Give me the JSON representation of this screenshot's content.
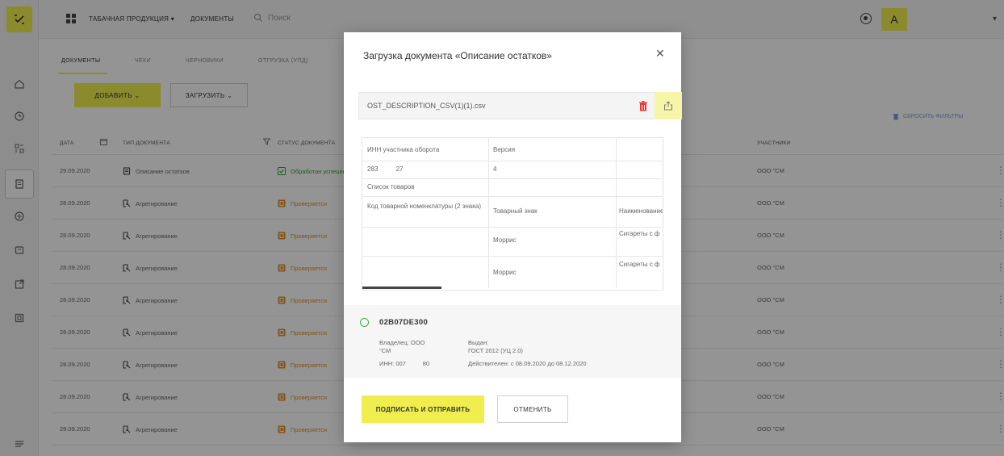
{
  "topbar": {
    "product_menu": "ТАБАЧНАЯ ПРОДУКЦИЯ",
    "documents_link": "ДОКУМЕНТЫ",
    "search_placeholder": "Поиск",
    "avatar_letter": "A"
  },
  "tabs": [
    "ДОКУМЕНТЫ",
    "ЧЕКИ",
    "ЧЕРНОВИКИ",
    "ОТГРУЗКА (УПД)"
  ],
  "toolbar": {
    "add_label": "ДОБАВИТЬ",
    "load_label": "ЗАГРУЗИТЬ",
    "clear_filters": "Сбросить фильтры"
  },
  "table": {
    "headers": {
      "date": "ДАТА",
      "doc_type": "ТИП ДОКУМЕНТА",
      "status": "СТАТУС ДОКУМЕНТА",
      "participants": "УЧАСТНИКИ"
    },
    "rows": [
      {
        "date": "29.09.2020",
        "type": "Описание остатков",
        "status": "Обработан успешно",
        "status_kind": "ok",
        "participant": "ООО \"СМ"
      },
      {
        "date": "28.09.2020",
        "type": "Агрегирование",
        "status": "Проверяется",
        "status_kind": "warn",
        "participant": "ООО \"СМ"
      },
      {
        "date": "28.09.2020",
        "type": "Агрегирование",
        "status": "Проверяется",
        "status_kind": "warn",
        "participant": "ООО \"СМ"
      },
      {
        "date": "28.09.2020",
        "type": "Агрегирование",
        "status": "Проверяется",
        "status_kind": "warn",
        "participant": "ООО \"СМ"
      },
      {
        "date": "28.09.2020",
        "type": "Агрегирование",
        "status": "Проверяется",
        "status_kind": "warn",
        "participant": "ООО \"СМ"
      },
      {
        "date": "28.09.2020",
        "type": "Агрегирование",
        "status": "Проверяется",
        "status_kind": "warn",
        "participant": "ООО \"СМ"
      },
      {
        "date": "28.09.2020",
        "type": "Агрегирование",
        "status": "Проверяется",
        "status_kind": "warn",
        "participant": "ООО \"СМ"
      },
      {
        "date": "28.09.2020",
        "type": "Агрегирование",
        "status": "Проверяется",
        "status_kind": "warn",
        "participant": "ООО \"СМ"
      },
      {
        "date": "28.09.2020",
        "type": "Агрегирование",
        "status": "Проверяется",
        "status_kind": "warn",
        "participant": "ООО \"СМ"
      }
    ]
  },
  "modal": {
    "title": "Загрузка документа «Описание остатков»",
    "close_glyph": "✕",
    "file_name": "OST_DESCRIPTION_CSV(1)(1).csv",
    "preview": {
      "inn_label": "ИНН участника оборота",
      "version_label": "Версия",
      "inn_value": "283          27",
      "version_value": "4",
      "goods_list": "Список товаров",
      "col_code": "Код товарной номенклатуры (2 знака)",
      "col_brand": "Товарный знак",
      "col_name": "Наименование",
      "row1_brand": "Моррис",
      "row1_name": "Сигареты с ф",
      "row2_brand": "Моррис",
      "row2_name": "Сигареты с ф"
    },
    "signature": {
      "id": "02B07DE300",
      "owner_label": "Владелец: ООО",
      "owner_suffix": "\"СМ",
      "inn": "ИНН: 007          80",
      "issued_label": "Выдан:",
      "issued_value": "ГОСТ 2012 (УЦ 2.0)",
      "validity": "Действителен: с 08.09.2020 до 08.12.2020"
    },
    "sign_button": "ПОДПИСАТЬ И ОТПРАВИТЬ",
    "cancel_button": "ОТМЕНИТЬ"
  },
  "colors": {
    "accent": "#f0ee4f",
    "overlay": "rgba(0,0,0,0.42)",
    "ok": "#3c9a3c",
    "warn": "#e0902a",
    "delete": "#e53935"
  }
}
